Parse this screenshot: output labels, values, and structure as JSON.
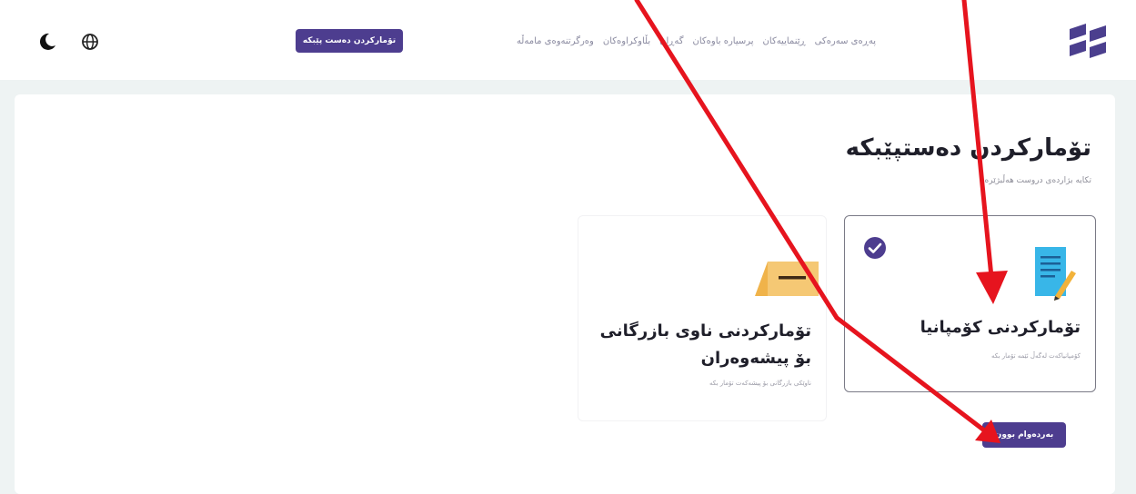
{
  "header": {
    "nav": [
      {
        "label": "پەڕەی سەرەکی"
      },
      {
        "label": "ڕێنماییەکان"
      },
      {
        "label": "پرسیارە باوەکان"
      },
      {
        "label": "گەڕان"
      },
      {
        "label": "بڵاوکراوەکان"
      },
      {
        "label": "وەرگرتنەوەی مامەڵە"
      }
    ],
    "login_label": "تۆمارکردن دەست پێبکە"
  },
  "main": {
    "title": "تۆمارکردن دەستپێبکە",
    "subtitle": "تکایە بژاردەی دروست هەڵبژێرە",
    "cards": [
      {
        "title": "تۆمارکردنی کۆمپانیا",
        "desc": "کۆمپانیاکەت لەگەڵ ئێمە تۆمار بکە",
        "selected": true,
        "icon": "document-pencil-icon"
      },
      {
        "title": "تۆمارکردنی ناوی بازرگانی بۆ پیشەوەران",
        "desc": "ناوێکی بازرگانی بۆ پیشەکەت تۆمار بکە",
        "selected": false,
        "icon": "tent-icon"
      }
    ],
    "next_label": "بەردەوام بوون"
  },
  "colors": {
    "accent": "#4d3d8f",
    "annotation": "#e6141e"
  }
}
